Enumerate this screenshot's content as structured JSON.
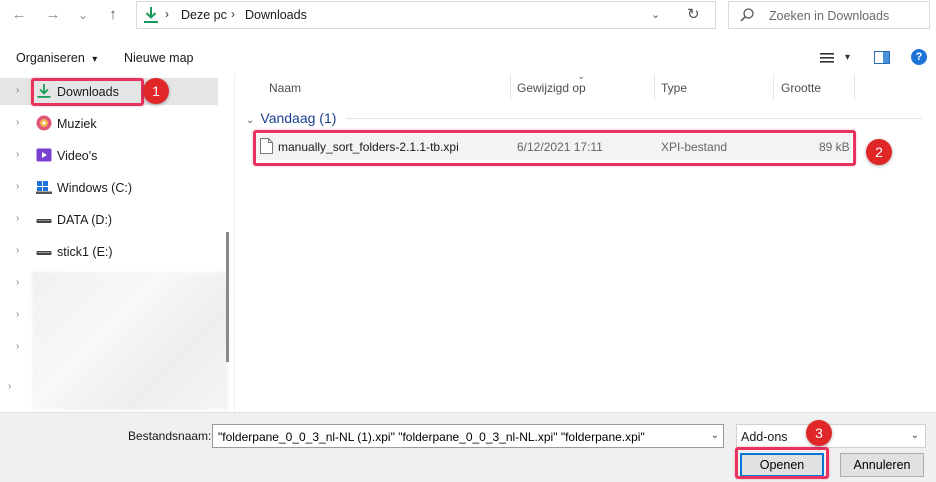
{
  "nav": {
    "back_glyph": "←",
    "forward_glyph": "→",
    "recent_glyph": "⌄",
    "up_glyph": "↑",
    "breadcrumb": [
      "Deze pc",
      "Downloads"
    ],
    "separator_glyph": "›",
    "dropdown_glyph": "⌄",
    "refresh_glyph": "↻",
    "search_placeholder": "Zoeken in Downloads"
  },
  "toolbar": {
    "organize_label": "Organiseren",
    "organize_caret": "▾",
    "new_folder_label": "Nieuwe map",
    "view_caret": "▾",
    "help_glyph": "?"
  },
  "sidebar": {
    "expand_glyph": "›",
    "items": [
      {
        "label": "Downloads",
        "icon": "download-icon",
        "selected": true
      },
      {
        "label": "Muziek",
        "icon": "music-icon"
      },
      {
        "label": "Video's",
        "icon": "video-icon"
      },
      {
        "label": "Windows (C:)",
        "icon": "windows-drive-icon"
      },
      {
        "label": "DATA (D:)",
        "icon": "drive-icon"
      },
      {
        "label": "stick1 (E:)",
        "icon": "usb-drive-icon"
      }
    ]
  },
  "columns": {
    "name": "Naam",
    "modified": "Gewijzigd op",
    "type": "Type",
    "size": "Grootte",
    "sort_glyph": "⌄"
  },
  "group": {
    "chevron": "⌄",
    "label": "Vandaag (1)"
  },
  "files": [
    {
      "name": "manually_sort_folders-2.1.1-tb.xpi",
      "modified": "6/12/2021 17:11",
      "type": "XPI-bestand",
      "size": "89 kB"
    }
  ],
  "footer": {
    "filename_label": "Bestandsnaam:",
    "filename_value": "\"folderpane_0_0_3_nl-NL (1).xpi\" \"folderpane_0_0_3_nl-NL.xpi\" \"folderpane.xpi\"",
    "dropdown_glyph": "⌄",
    "filter_value": "Add-ons",
    "open_label": "Openen",
    "cancel_label": "Annuleren"
  },
  "annotations": [
    {
      "label": "1"
    },
    {
      "label": "2"
    },
    {
      "label": "3"
    }
  ],
  "colors": {
    "accent": "#0078d7",
    "highlight": "#e8335e",
    "marker": "#e02626",
    "download_green": "#1a9a5a",
    "group_blue": "#1a3f8f"
  }
}
